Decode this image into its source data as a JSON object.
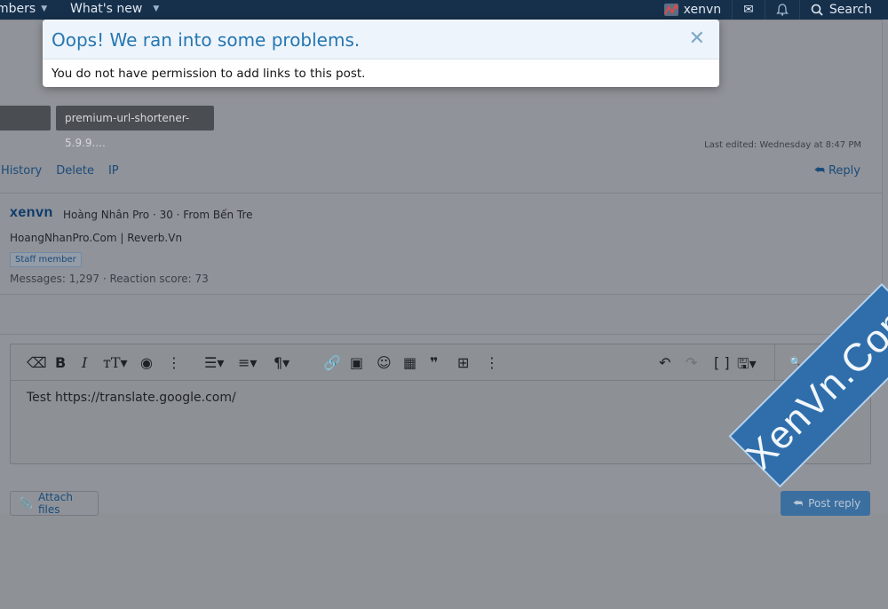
{
  "topbar": {
    "nav_items": [
      {
        "label": "mbers"
      },
      {
        "label": "What's new"
      }
    ],
    "user": "xenvn",
    "search": "Search",
    "icons": [
      "mail-icon",
      "bell-icon",
      "search-icon"
    ]
  },
  "post": {
    "attachment_label": "premium-url-shortener-5.9.9....",
    "last_edited": "Last edited: Wednesday at 8:47 PM",
    "actions": [
      "History",
      "Delete",
      "IP"
    ],
    "reply": "Reply"
  },
  "signature": {
    "brand": "xenvn",
    "info": "Hoàng Nhân Pro · 30 · From Bến Tre",
    "sites": "HoangNhanPro.Com | Reverb.Vn",
    "badge": "Staff member",
    "stats": "Messages: 1,297 · Reaction score: 73"
  },
  "editor": {
    "content": "Test https://translate.google.com/",
    "preview": "Preview",
    "attach": "Attach files",
    "post_reply": "Post reply"
  },
  "dialog": {
    "title": "Oops! We ran into some problems.",
    "message": "You do not have permission to add links to this post.",
    "close": "✕"
  },
  "watermark": "XenVn.Com",
  "colors": {
    "topbar": "#16304c",
    "dialog_title": "#2577b1",
    "link": "#1b4b7a"
  }
}
